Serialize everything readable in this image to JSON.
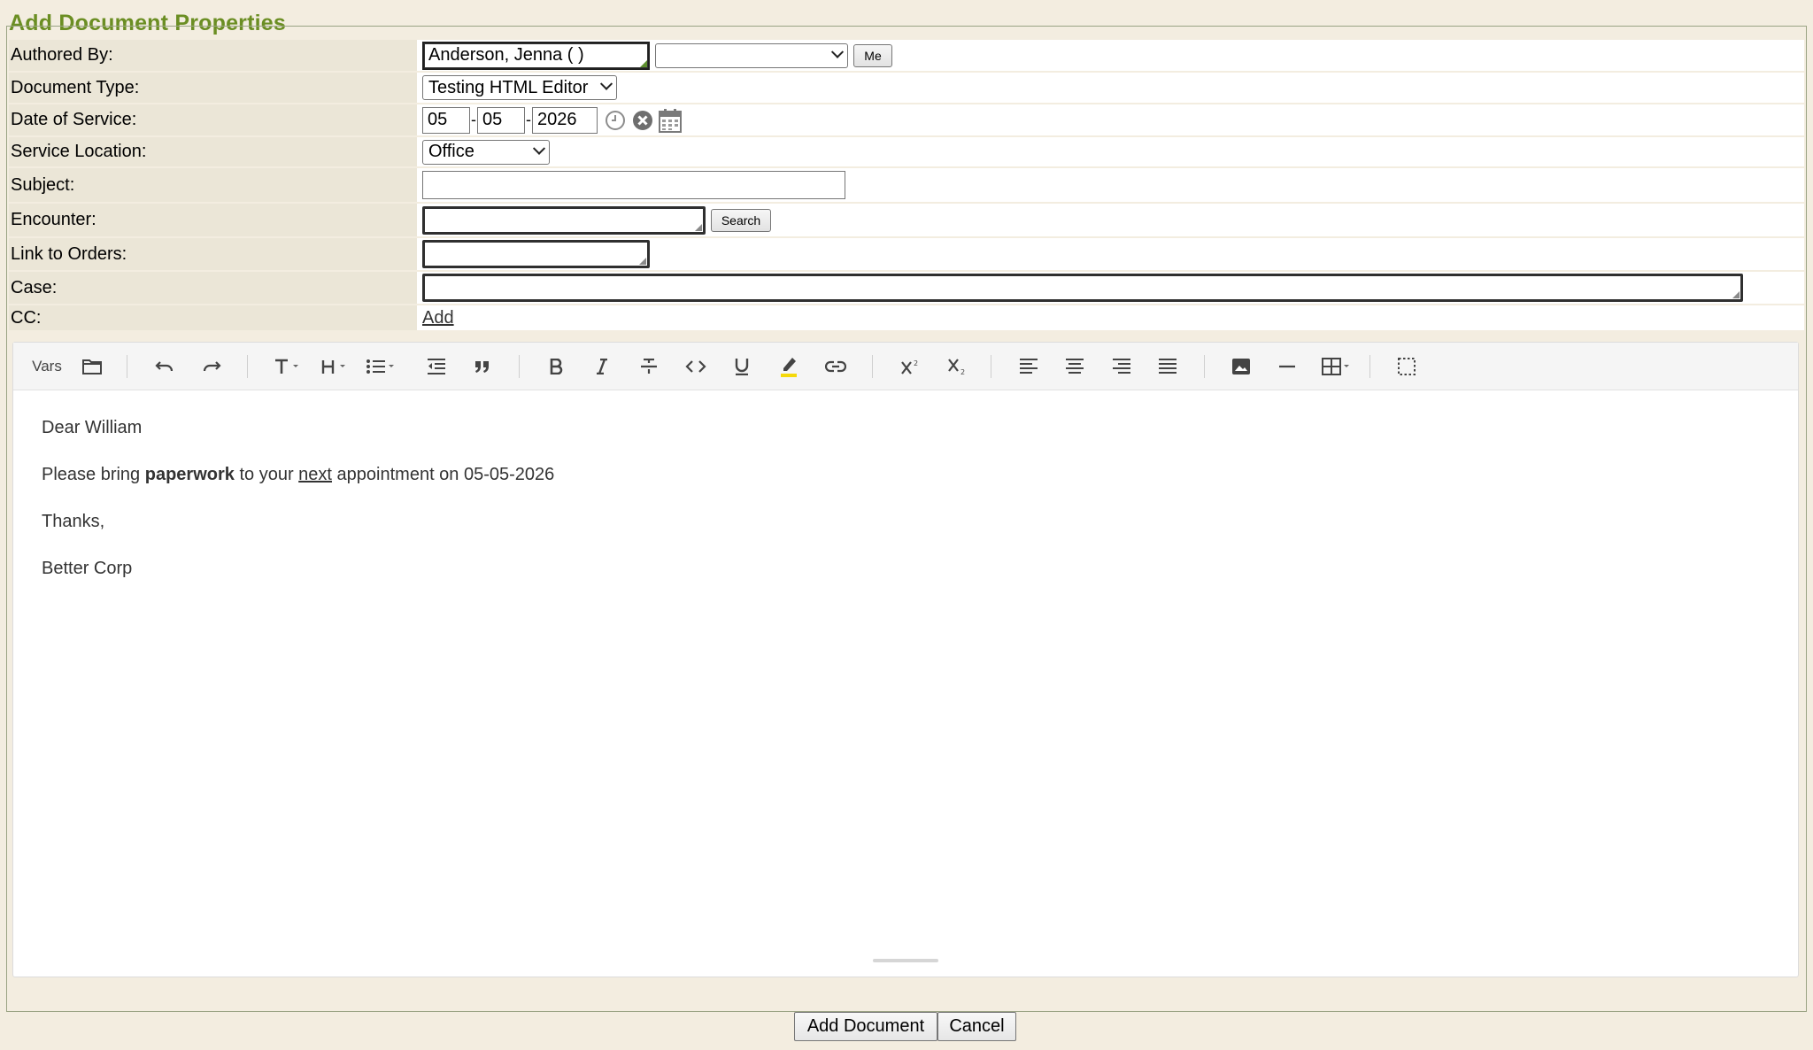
{
  "title": "Add Document Properties",
  "form": {
    "authored_by": {
      "label": "Authored By:",
      "value": "Anderson, Jenna (  )",
      "select_value": "",
      "me_button": "Me"
    },
    "document_type": {
      "label": "Document Type:",
      "value": "Testing HTML Editor"
    },
    "date_of_service": {
      "label": "Date of Service:",
      "month": "05",
      "day": "05",
      "year": "2026",
      "sep": "-"
    },
    "service_location": {
      "label": "Service Location:",
      "value": "Office"
    },
    "subject": {
      "label": "Subject:",
      "value": ""
    },
    "encounter": {
      "label": "Encounter:",
      "value": "",
      "search_button": "Search"
    },
    "link_to_orders": {
      "label": "Link to Orders:",
      "value": ""
    },
    "case": {
      "label": "Case:",
      "value": ""
    },
    "cc": {
      "label": "CC:",
      "add_link": "Add"
    }
  },
  "editor": {
    "toolbar": {
      "vars_label": "Vars",
      "icons": [
        "folder-icon",
        "undo-icon",
        "redo-icon",
        "text-size-icon",
        "heading-icon",
        "list-icon",
        "outdent-icon",
        "quote-icon",
        "bold-icon",
        "italic-icon",
        "strikethrough-icon",
        "code-icon",
        "underline-icon",
        "highlight-icon",
        "link-icon",
        "superscript-icon",
        "subscript-icon",
        "align-left-icon",
        "align-center-icon",
        "align-right-icon",
        "align-justify-icon",
        "image-icon",
        "horizontal-rule-icon",
        "table-icon",
        "select-all-icon"
      ],
      "accent_highlight": "#f5d90a"
    },
    "content": {
      "line1": "Dear William",
      "line2_a": "Please bring ",
      "line2_bold": "paperwork",
      "line2_b": " to your ",
      "line2_underline": "next",
      "line2_c": " appointment on 05-05-2026",
      "line3": "Thanks,",
      "line4": "Better Corp"
    }
  },
  "footer": {
    "add_document": "Add Document",
    "cancel": "Cancel"
  },
  "colors": {
    "title_green": "#6b8e23",
    "page_bg": "#f3ede0",
    "label_bg": "#ebe6d7"
  }
}
